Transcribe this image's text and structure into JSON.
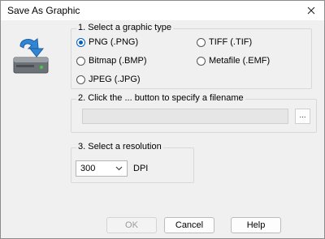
{
  "window": {
    "title": "Save As Graphic"
  },
  "icons": {
    "app": "save-to-drive-icon",
    "close": "close-icon",
    "dropdown": "chevron-down-icon"
  },
  "graphic_type": {
    "legend": "1. Select a graphic type",
    "options": [
      {
        "label": "PNG (.PNG)",
        "checked": true
      },
      {
        "label": "TIFF (.TIF)",
        "checked": false
      },
      {
        "label": "Bitmap (.BMP)",
        "checked": false
      },
      {
        "label": "Metafile (.EMF)",
        "checked": false
      },
      {
        "label": "JPEG (.JPG)",
        "checked": false
      }
    ]
  },
  "filename": {
    "legend": "2. Click the ... button to specify a filename",
    "value": "",
    "browse_label": "..."
  },
  "resolution": {
    "legend": "3. Select a resolution",
    "selected": "300",
    "unit": "DPI"
  },
  "buttons": {
    "ok": "OK",
    "cancel": "Cancel",
    "help": "Help"
  },
  "colors": {
    "accent": "#0060c0",
    "dialog_bg": "#f0f0f0",
    "icon_blue": "#2f86d6"
  }
}
